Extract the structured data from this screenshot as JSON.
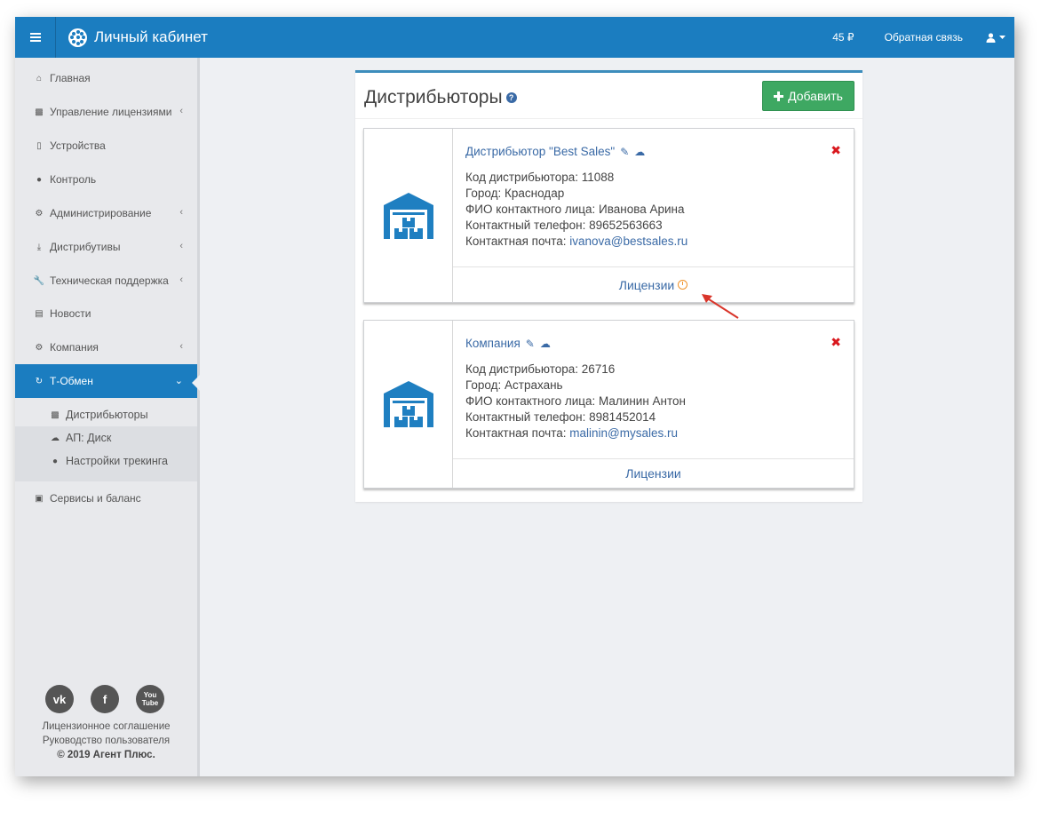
{
  "app": {
    "title": "Личный кабинет"
  },
  "topbar": {
    "balance": "45 ₽",
    "feedback": "Обратная связь"
  },
  "sidebar": {
    "items": [
      {
        "label": "Главная",
        "icon": "home-icon"
      },
      {
        "label": "Управление лицензиями",
        "icon": "sitemap-icon"
      },
      {
        "label": "Устройства",
        "icon": "mobile-icon"
      },
      {
        "label": "Контроль",
        "icon": "globe-icon"
      },
      {
        "label": "Администрирование",
        "icon": "cogs-icon"
      },
      {
        "label": "Дистрибутивы",
        "icon": "download-icon"
      },
      {
        "label": "Техническая поддержка",
        "icon": "wrench-icon"
      },
      {
        "label": "Новости",
        "icon": "newspaper-icon"
      },
      {
        "label": "Компания",
        "icon": "gear-icon"
      },
      {
        "label": "Т-Обмен",
        "icon": "refresh-icon"
      },
      {
        "label": "Сервисы и баланс",
        "icon": "money-icon"
      }
    ],
    "submenu": [
      {
        "label": "Дистрибьюторы",
        "icon": "sitemap-icon"
      },
      {
        "label": "АП: Диск",
        "icon": "cloud-icon"
      },
      {
        "label": "Настройки трекинга",
        "icon": "globe-icon"
      }
    ],
    "footer": {
      "license": "Лицензионное соглашение",
      "guide": "Руководство пользователя",
      "copyright": "© 2019 Агент Плюс."
    }
  },
  "main": {
    "title": "Дистрибьюторы",
    "add_button": "Добавить",
    "cards": [
      {
        "title": "Дистрибьютор \"Best Sales\"",
        "code": "Код дистрибьютора: 11088",
        "city": "Город: Краснодар",
        "contact": "ФИО контактного лица: Иванова Арина",
        "phone": "Контактный телефон: 89652563663",
        "email_label": "Контактная почта: ",
        "email": "ivanova@bestsales.ru",
        "licenses": "Лицензии"
      },
      {
        "title": "Компания",
        "code": "Код дистрибьютора: 26716",
        "city": "Город: Астрахань",
        "contact": "ФИО контактного лица: Малинин Антон",
        "phone": "Контактный телефон: 8981452014",
        "email_label": "Контактная почта: ",
        "email": "malinin@mysales.ru",
        "licenses": "Лицензии"
      }
    ]
  },
  "colors": {
    "primary": "#1b7dc0",
    "success": "#3ea862",
    "danger": "#d9181e",
    "link": "#3a6aa6",
    "pending": "#f0932b"
  }
}
